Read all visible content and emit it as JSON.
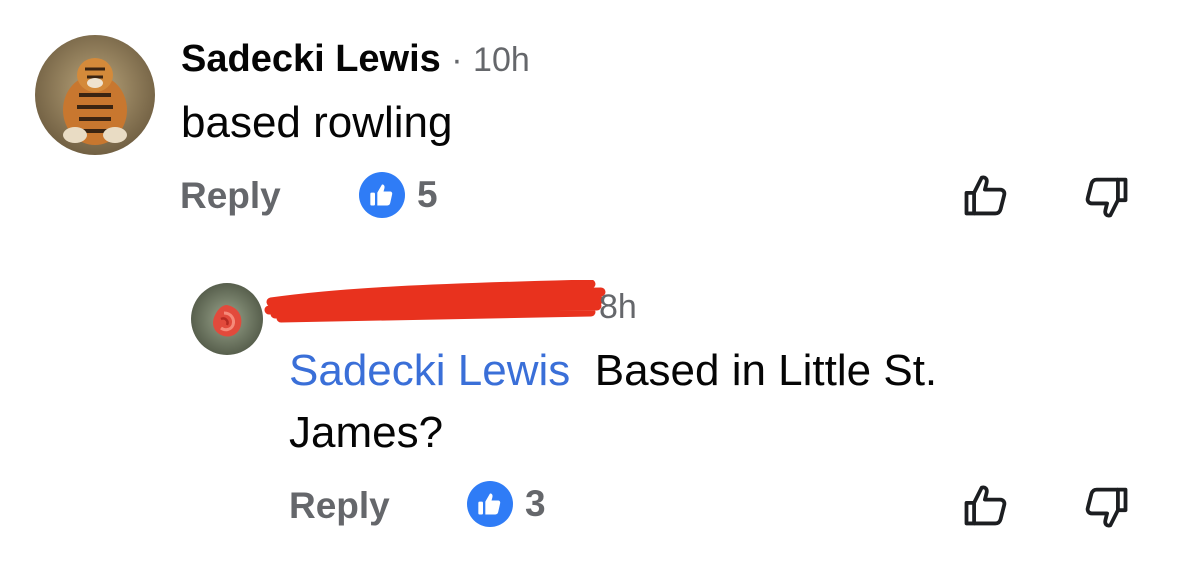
{
  "comments": [
    {
      "author": "Sadecki Lewis",
      "separator": "·",
      "time": "10h",
      "text": "based rowling",
      "reply_label": "Reply",
      "like_count": "5",
      "avatar": "tiger-avatar"
    },
    {
      "author": "(redacted)",
      "time": "8h",
      "mention": "Sadecki Lewis",
      "text_line1": "Based in Little St.",
      "text_line2": "James?",
      "reply_label": "Reply",
      "like_count": "3",
      "avatar": "red-flower-avatar",
      "redaction_color": "#e8321e"
    }
  ],
  "colors": {
    "like_blue": "#2f7cf6",
    "mention_blue": "#3a6fd8",
    "meta_gray": "#65676b"
  }
}
